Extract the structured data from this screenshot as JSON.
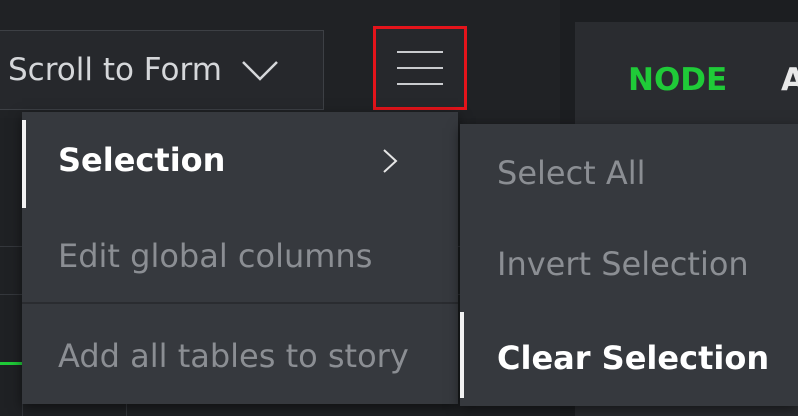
{
  "toolbar": {
    "scroll_select_value": "Scroll to Form",
    "menu_button_icon": "hamburger-icon",
    "highlight_color": "#e4141b"
  },
  "header": {
    "node_label": "NODE",
    "node_label_color": "#1fcb38",
    "next_label": "A"
  },
  "menu": {
    "items": [
      {
        "label": "Selection",
        "state": "active",
        "has_submenu": true
      },
      {
        "label": "Edit global columns",
        "state": "disabled"
      },
      {
        "label": "Add all tables to story",
        "state": "disabled"
      }
    ]
  },
  "submenu": {
    "items": [
      {
        "label": "Select All",
        "state": "disabled"
      },
      {
        "label": "Invert Selection",
        "state": "disabled"
      },
      {
        "label": "Clear Selection",
        "state": "active"
      }
    ]
  }
}
